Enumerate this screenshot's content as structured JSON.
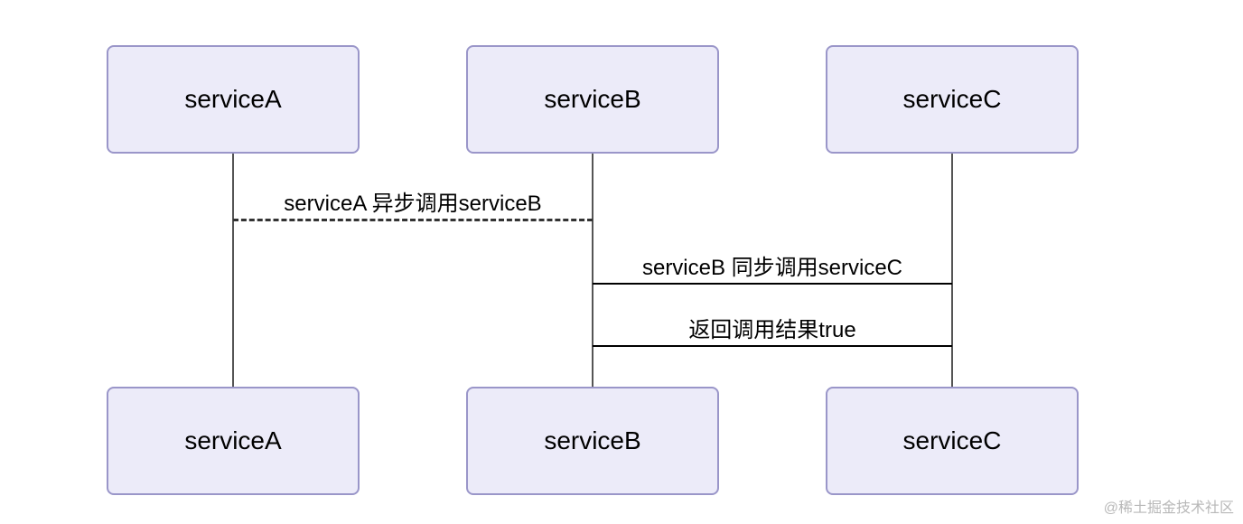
{
  "participants": {
    "a": {
      "label": "serviceA"
    },
    "b": {
      "label": "serviceB"
    },
    "c": {
      "label": "serviceC"
    }
  },
  "messages": {
    "m1": {
      "text": "serviceA 异步调用serviceB"
    },
    "m2": {
      "text": "serviceB 同步调用serviceC"
    },
    "m3": {
      "text": "返回调用结果true"
    }
  },
  "watermark": "@稀土掘金技术社区"
}
